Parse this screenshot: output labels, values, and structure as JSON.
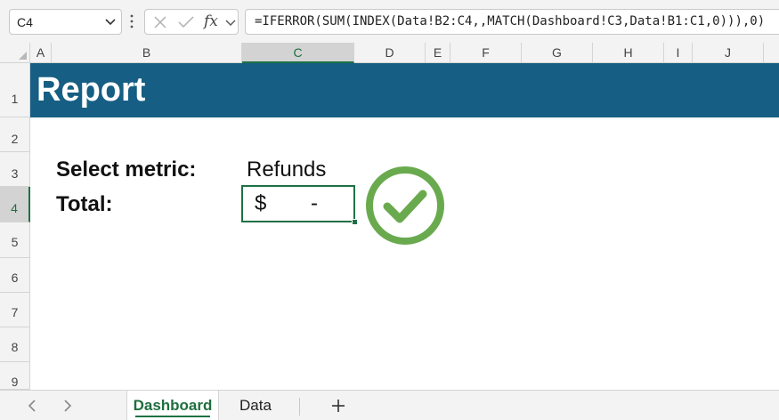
{
  "formula_bar": {
    "name_box": "C4",
    "fx": "fx",
    "formula": "=IFERROR(SUM(INDEX(Data!B2:C4,,MATCH(Dashboard!C3,Data!B1:C1,0))),0)"
  },
  "columns": [
    "A",
    "B",
    "C",
    "D",
    "E",
    "F",
    "G",
    "H",
    "I",
    "J"
  ],
  "rows": [
    "1",
    "2",
    "3",
    "4",
    "5",
    "6",
    "7",
    "8",
    "9"
  ],
  "selected_cell": {
    "column": "C",
    "row": "4"
  },
  "sheet": {
    "banner_title": "Report",
    "select_metric_label": "Select metric:",
    "select_metric_value": "Refunds",
    "total_label": "Total:",
    "total_currency": "$",
    "total_value": "-",
    "status_icon": "check-circle-icon",
    "status_color": "#6aaa4e",
    "banner_color": "#165e83"
  },
  "tabs": [
    {
      "label": "Dashboard",
      "active": true
    },
    {
      "label": "Data",
      "active": false
    }
  ],
  "icons": {
    "prev_sheet": "chevron-left-icon",
    "next_sheet": "chevron-right-icon",
    "add_sheet": "plus-icon",
    "cancel": "x-icon",
    "enter": "check-icon"
  },
  "accent_color": "#1e7145"
}
